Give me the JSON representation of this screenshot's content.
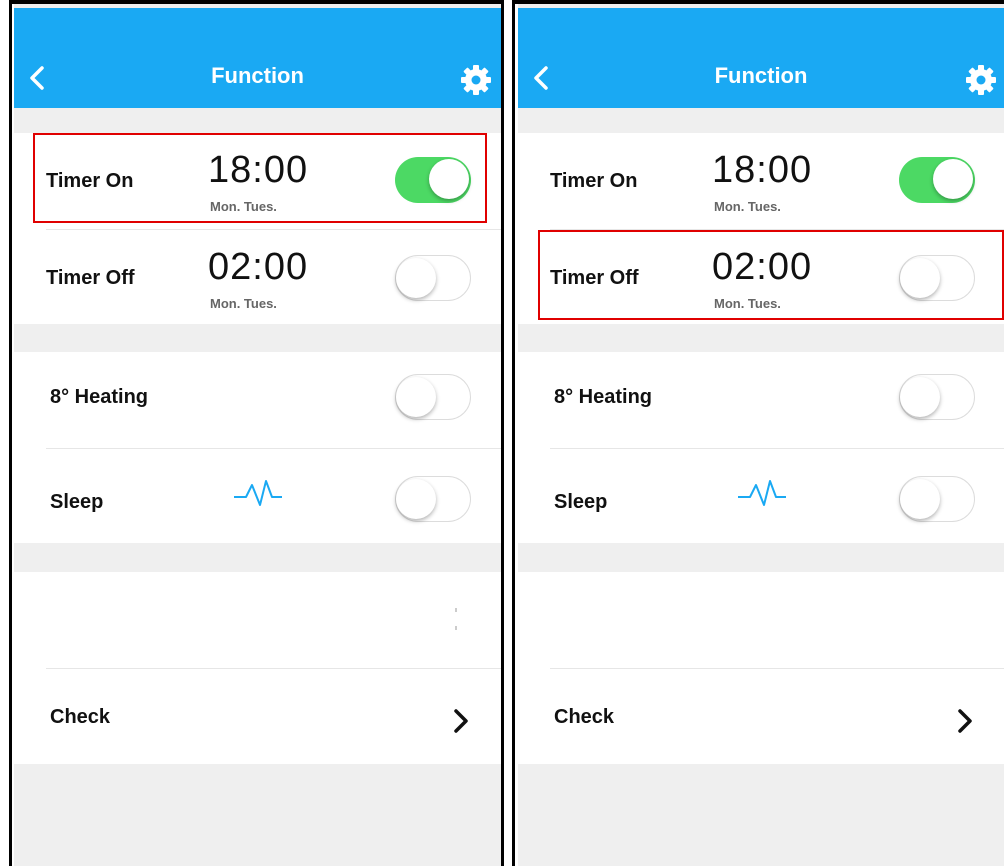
{
  "header": {
    "title": "Function",
    "back_icon": "chevron-left-icon",
    "settings_icon": "gear-icon"
  },
  "colors": {
    "header": "#1aa9f3",
    "toggle_on": "#4cd964",
    "highlight": "#e00000",
    "pulse": "#1aa9f3"
  },
  "panels": [
    {
      "highlighted_row": "timer_on",
      "timer_on": {
        "label": "Timer On",
        "time": "18:00",
        "days": "Mon. Tues.",
        "enabled": true
      },
      "timer_off": {
        "label": "Timer Off",
        "time": "02:00",
        "days": "Mon. Tues.",
        "enabled": false
      },
      "heating": {
        "label": "8° Heating",
        "enabled": false
      },
      "sleep": {
        "label": "Sleep",
        "icon": "pulse-icon",
        "enabled": false
      },
      "check": {
        "label": "Check",
        "icon": "chevron-right-icon"
      }
    },
    {
      "highlighted_row": "timer_off",
      "timer_on": {
        "label": "Timer On",
        "time": "18:00",
        "days": "Mon. Tues.",
        "enabled": true
      },
      "timer_off": {
        "label": "Timer Off",
        "time": "02:00",
        "days": "Mon. Tues.",
        "enabled": false
      },
      "heating": {
        "label": "8° Heating",
        "enabled": false
      },
      "sleep": {
        "label": "Sleep",
        "icon": "pulse-icon",
        "enabled": false
      },
      "check": {
        "label": "Check",
        "icon": "chevron-right-icon"
      }
    }
  ]
}
